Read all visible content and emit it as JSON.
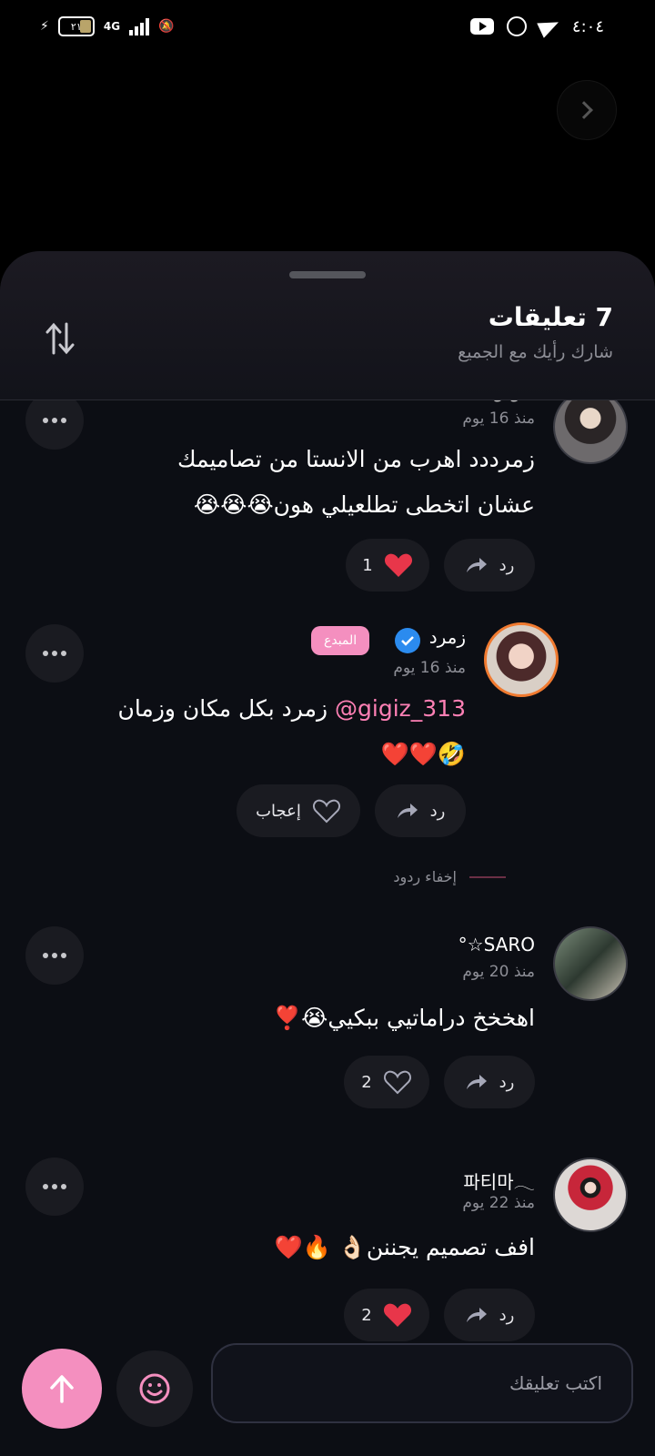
{
  "status_bar": {
    "time": "٤:٠٤",
    "battery": "٢١",
    "network": "4G"
  },
  "sheet": {
    "title": "7 تعليقات",
    "subtitle": "شارك رأيك مع الجميع"
  },
  "comments": [
    {
      "username": "gigiz",
      "time": "منذ 16 يوم",
      "line1": "زمرددد اهرب من الانستا من تصاميمك",
      "line2": "عشان اتخطى تطلعيلي هون😭😭😭",
      "reply_label": "رد",
      "like_count": "1"
    },
    {
      "username": "زمرد",
      "badge": "المبدع",
      "time": "منذ 16 يوم",
      "mention": "gigiz_313@",
      "text_after_mention": " زمرد بكل مكان وزمان",
      "line2": "🤣❤️❤️",
      "reply_label": "رد",
      "like_label": "إعجاب"
    },
    {
      "username": "SARO☆°",
      "time": "منذ 20 يوم",
      "line1": "اهخخخ دراماتيي ببكيي😭❣️",
      "reply_label": "رد",
      "like_count": "2"
    },
    {
      "username": "파티마𓂃",
      "time": "منذ 22 يوم",
      "line1": "افف تصميم يجننن👌🏻    🔥❤️",
      "reply_label": "رد",
      "like_count": "2"
    }
  ],
  "hide_replies": "إخفاء ردود",
  "input": {
    "placeholder": "اكتب تعليقك"
  },
  "colors": {
    "accent": "#f48fbf",
    "verified": "#2b8bef",
    "heart": "#e8364a"
  }
}
